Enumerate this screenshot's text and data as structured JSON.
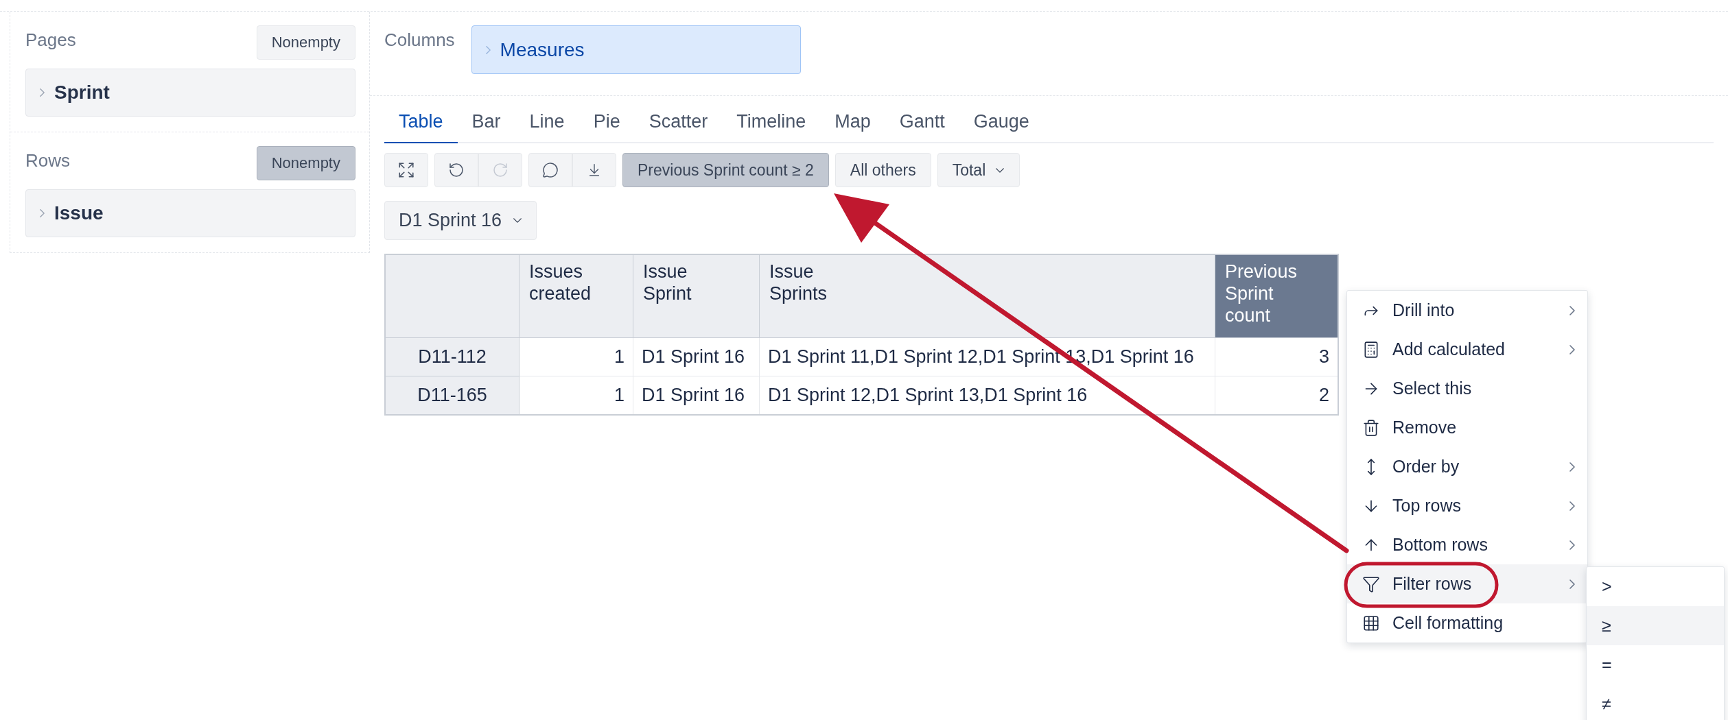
{
  "pages": {
    "title": "Pages",
    "nonempty": {
      "label": "Nonempty",
      "selected": false
    },
    "items": [
      {
        "label": "Sprint"
      }
    ]
  },
  "rows": {
    "title": "Rows",
    "nonempty": {
      "label": "Nonempty",
      "selected": true
    },
    "items": [
      {
        "label": "Issue"
      }
    ]
  },
  "columns": {
    "title": "Columns",
    "items": [
      {
        "label": "Measures"
      }
    ]
  },
  "tabs": [
    {
      "label": "Table",
      "selected": true
    },
    {
      "label": "Bar",
      "selected": false
    },
    {
      "label": "Line",
      "selected": false
    },
    {
      "label": "Pie",
      "selected": false
    },
    {
      "label": "Scatter",
      "selected": false
    },
    {
      "label": "Timeline",
      "selected": false
    },
    {
      "label": "Map",
      "selected": false
    },
    {
      "label": "Gantt",
      "selected": false
    },
    {
      "label": "Gauge",
      "selected": false
    }
  ],
  "toolbar": {
    "undo_disabled": false,
    "redo_disabled": true,
    "filter_button": {
      "label": "Previous Sprint count ≥ 2",
      "selected": true
    },
    "all_others_button": {
      "label": "All others",
      "selected": false
    },
    "total_dropdown": {
      "label": "Total"
    }
  },
  "page_filter": {
    "value": "D1 Sprint 16"
  },
  "table": {
    "columns": [
      {
        "label": "Issues\ncreated",
        "kind": "number",
        "selected": false
      },
      {
        "label": "Issue\nSprint",
        "kind": "text",
        "selected": false
      },
      {
        "label": "Issue\nSprints",
        "kind": "text",
        "selected": false
      },
      {
        "label": "Previous\nSprint\ncount",
        "kind": "number",
        "selected": true
      }
    ],
    "rows": [
      {
        "header": "D11-112",
        "cells": [
          "1",
          "D1 Sprint 16",
          "D1 Sprint 11,D1 Sprint 12,D1 Sprint 13,D1 Sprint 16",
          "3"
        ]
      },
      {
        "header": "D11-165",
        "cells": [
          "1",
          "D1 Sprint 16",
          "D1 Sprint 12,D1 Sprint 13,D1 Sprint 16",
          "2"
        ]
      }
    ]
  },
  "context_menu": {
    "items": [
      {
        "kind": "drill",
        "label": "Drill into",
        "has_submenu": true,
        "selected": false
      },
      {
        "kind": "calculated",
        "label": "Add calculated",
        "has_submenu": true,
        "selected": false
      },
      {
        "kind": "select",
        "label": "Select this",
        "has_submenu": false,
        "selected": false
      },
      {
        "kind": "remove",
        "label": "Remove",
        "has_submenu": false,
        "selected": false
      },
      {
        "kind": "order",
        "label": "Order by",
        "has_submenu": true,
        "selected": false
      },
      {
        "kind": "top",
        "label": "Top rows",
        "has_submenu": true,
        "selected": false
      },
      {
        "kind": "bottom",
        "label": "Bottom rows",
        "has_submenu": true,
        "selected": false
      },
      {
        "kind": "filter",
        "label": "Filter rows",
        "has_submenu": true,
        "selected": true
      },
      {
        "kind": "format",
        "label": "Cell formatting",
        "has_submenu": false,
        "selected": false
      }
    ]
  },
  "submenu": {
    "items": [
      {
        "label": ">",
        "selected": false
      },
      {
        "label": "≥",
        "selected": true
      },
      {
        "label": "=",
        "selected": false
      },
      {
        "label": "≠",
        "selected": false
      }
    ]
  }
}
